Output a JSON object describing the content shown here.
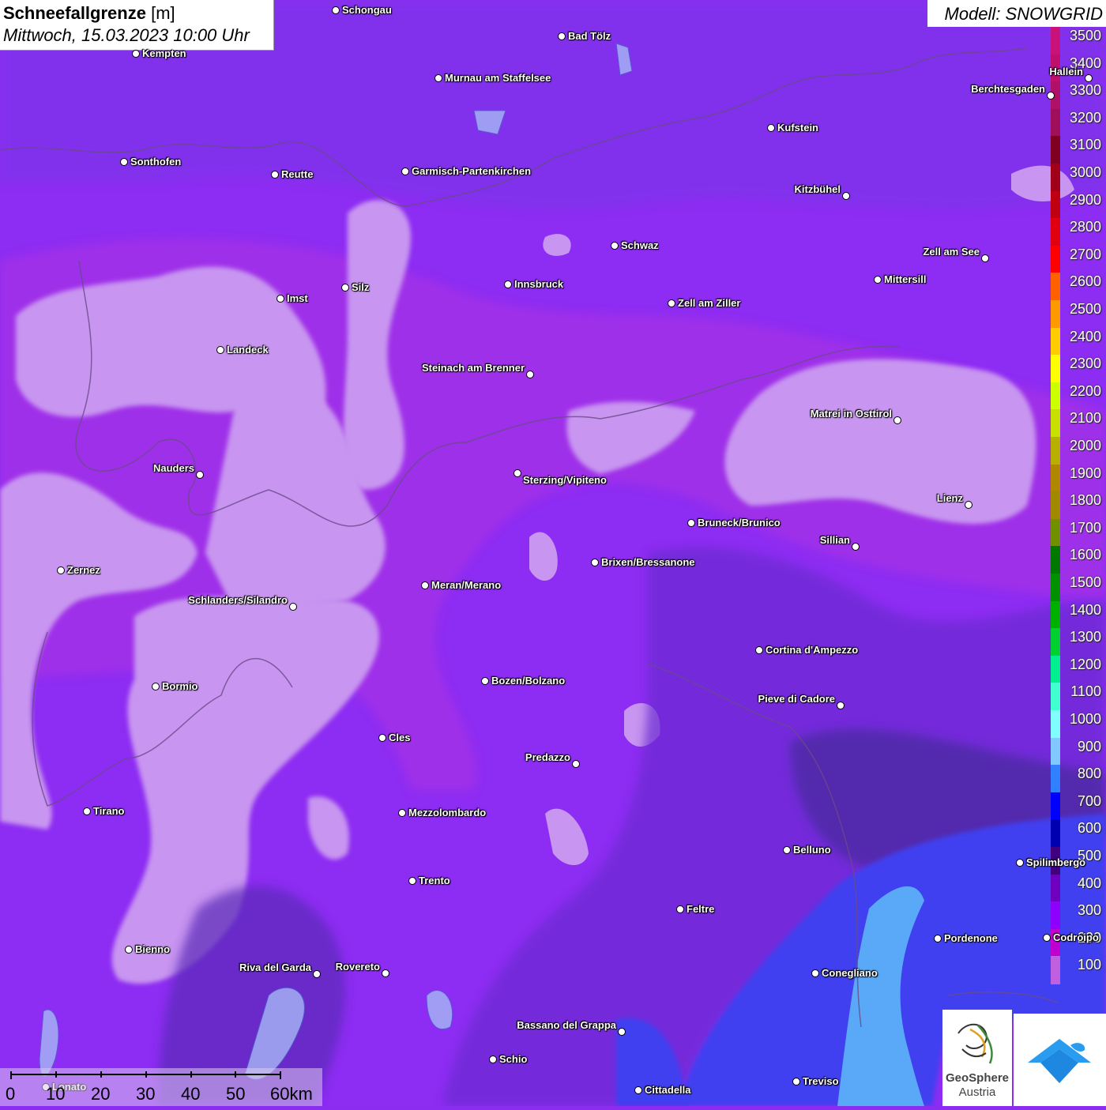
{
  "title": {
    "label": "Schneefallgrenze",
    "unit": "[m]",
    "datetime": "Mittwoch, 15.03.2023 10:00 Uhr"
  },
  "model": "Modell: SNOWGRID",
  "legend": {
    "values": [
      "3500",
      "3400",
      "3300",
      "3200",
      "3100",
      "3000",
      "2900",
      "2800",
      "2700",
      "2600",
      "2500",
      "2400",
      "2300",
      "2200",
      "2100",
      "2000",
      "1900",
      "1800",
      "1700",
      "1600",
      "1500",
      "1400",
      "1300",
      "1200",
      "1100",
      "1000",
      "900",
      "800",
      "700",
      "600",
      "500",
      "400",
      "300",
      "200",
      "100"
    ],
    "colors": [
      "#c8127a",
      "#c0106e",
      "#b01066",
      "#a0105a",
      "#800020",
      "#a00018",
      "#c00010",
      "#e00010",
      "#ff0000",
      "#ff6000",
      "#ff9900",
      "#ffcc00",
      "#ffff00",
      "#ccff00",
      "#c8e000",
      "#b8b000",
      "#b08800",
      "#a08800",
      "#709000",
      "#007800",
      "#009000",
      "#00b000",
      "#00d030",
      "#00f090",
      "#40ffd0",
      "#80ffff",
      "#80c8ff",
      "#3080ff",
      "#0000ff",
      "#0000b0",
      "#400080",
      "#7000c0",
      "#9000ff",
      "#c000d0",
      "#c060e0"
    ]
  },
  "cities": [
    {
      "name": "Schongau"
    },
    {
      "name": "Bad Tölz"
    },
    {
      "name": "Kempten"
    },
    {
      "name": "Murnau am Staffelsee"
    },
    {
      "name": "Hallein"
    },
    {
      "name": "Berchtesgaden"
    },
    {
      "name": "Kufstein"
    },
    {
      "name": "Sonthofen"
    },
    {
      "name": "Reutte"
    },
    {
      "name": "Garmisch-Partenkirchen"
    },
    {
      "name": "Kitzbühel"
    },
    {
      "name": "Schwaz"
    },
    {
      "name": "Zell am See"
    },
    {
      "name": "Innsbruck"
    },
    {
      "name": "Mittersill"
    },
    {
      "name": "Silz"
    },
    {
      "name": "Imst"
    },
    {
      "name": "Zell am Ziller"
    },
    {
      "name": "Landeck"
    },
    {
      "name": "Steinach am Brenner"
    },
    {
      "name": "Matrei in Osttirol"
    },
    {
      "name": "Nauders"
    },
    {
      "name": "Sterzing/Vipiteno"
    },
    {
      "name": "Lienz"
    },
    {
      "name": "Bruneck/Brunico"
    },
    {
      "name": "Sillian"
    },
    {
      "name": "Brixen/Bressanone"
    },
    {
      "name": "Zernez"
    },
    {
      "name": "Meran/Merano"
    },
    {
      "name": "Schlanders/Silandro"
    },
    {
      "name": "Cortina d'Ampezzo"
    },
    {
      "name": "Bozen/Bolzano"
    },
    {
      "name": "Bormio"
    },
    {
      "name": "Pieve di Cadore"
    },
    {
      "name": "Cles"
    },
    {
      "name": "Predazzo"
    },
    {
      "name": "Tirano"
    },
    {
      "name": "Mezzolombardo"
    },
    {
      "name": "Belluno"
    },
    {
      "name": "Spilimbergo"
    },
    {
      "name": "Trento"
    },
    {
      "name": "Feltre"
    },
    {
      "name": "Pordenone"
    },
    {
      "name": "Codroipo"
    },
    {
      "name": "Bienno"
    },
    {
      "name": "Riva del Garda"
    },
    {
      "name": "Rovereto"
    },
    {
      "name": "Conegliano"
    },
    {
      "name": "Bassano del Grappa"
    },
    {
      "name": "Schio"
    },
    {
      "name": "Treviso"
    },
    {
      "name": "Cittadella"
    },
    {
      "name": "Lonato"
    }
  ],
  "scale": {
    "ticks": [
      "0",
      "10",
      "20",
      "30",
      "40",
      "50",
      "60km"
    ]
  },
  "logo": {
    "line1": "GeoSphere",
    "line2": "Austria"
  }
}
